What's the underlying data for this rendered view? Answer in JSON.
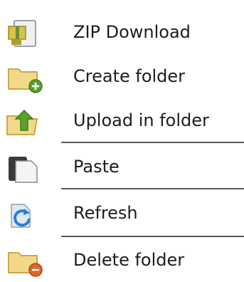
{
  "context_menu": {
    "items": [
      {
        "label": "ZIP Download",
        "icon": "zip-file-icon"
      },
      {
        "label": "Create folder",
        "icon": "folder-add-icon"
      },
      {
        "label": "Upload in folder",
        "icon": "folder-upload-icon"
      },
      {
        "label": "Paste",
        "icon": "paste-icon"
      },
      {
        "label": "Refresh",
        "icon": "refresh-icon"
      },
      {
        "label": "Delete folder",
        "icon": "folder-delete-icon"
      }
    ]
  },
  "colors": {
    "folder": "#f2d98a",
    "folder_dark": "#c9a94a",
    "green_accent": "#5aa12b",
    "blue_accent": "#2d7fd0",
    "orange_accent": "#e0672a",
    "separator": "#5a5a5a"
  }
}
